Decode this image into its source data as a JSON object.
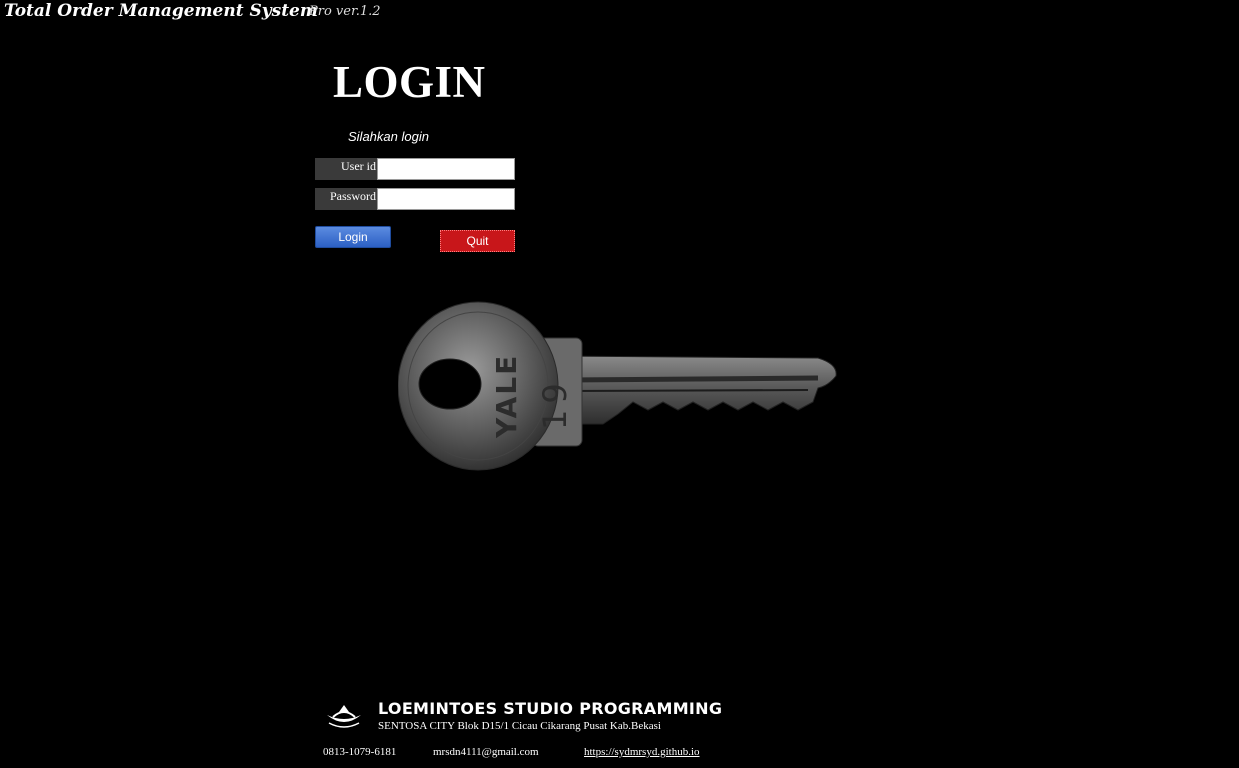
{
  "header": {
    "app_title": "Total Order Management System",
    "version": "Pro ver.1.2"
  },
  "login": {
    "heading": "LOGIN",
    "subtitle": "Silahkan login",
    "user_id_label": "User id",
    "user_id_value": "",
    "password_label": "Password",
    "password_value": "",
    "login_button": "Login",
    "quit_button": "Quit"
  },
  "key_image": {
    "engraving_brand": "YALE",
    "engraving_number": "19"
  },
  "footer": {
    "studio_name": "LOEMINTOES STUDIO PROGRAMMING",
    "address": "SENTOSA CITY Blok D15/1 Cicau Cikarang Pusat Kab.Bekasi",
    "phone": "0813-1079-6181",
    "email": "mrsdn4111@gmail.com",
    "website": "https://sydmrsyd.github.io"
  },
  "colors": {
    "background": "#000000",
    "login_button": "#3a6fd0",
    "quit_button": "#c8161a",
    "label_background": "#3a3a3a"
  }
}
